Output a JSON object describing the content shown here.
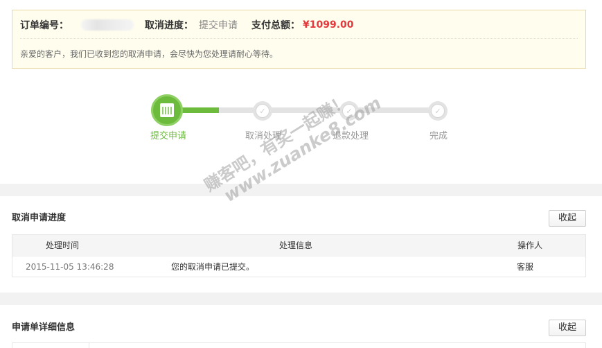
{
  "notice": {
    "order_label": "订单编号：",
    "progress_label": "取消进度：",
    "progress_value": "提交申请",
    "total_label": "支付总额：",
    "total_value": "¥1099.00",
    "message": "亲爱的客户，我们已收到您的取消申请，会尽快为您处理请耐心等待。"
  },
  "steps": [
    {
      "label": "提交申请",
      "state": "active",
      "icon": "calendar-icon"
    },
    {
      "label": "取消处理",
      "state": "pending",
      "icon": "check-icon"
    },
    {
      "label": "退款处理",
      "state": "pending",
      "icon": "check-icon"
    },
    {
      "label": "完成",
      "state": "pending",
      "icon": "check-icon"
    }
  ],
  "progress_section": {
    "title": "取消申请进度",
    "collapse_label": "收起",
    "columns": {
      "time": "处理时间",
      "info": "处理信息",
      "operator": "操作人"
    },
    "rows": [
      {
        "time": "2015-11-05 13:46:28",
        "info": "您的取消申请已提交。",
        "operator": "客服"
      }
    ]
  },
  "detail_section": {
    "title": "申请单详细信息",
    "collapse_label": "收起"
  },
  "watermark": {
    "line1": "赚客吧，有奖一起赚！",
    "line2": "www.zuanke8.com"
  },
  "colors": {
    "accent_green": "#6cbb3c",
    "price_red": "#e4393c",
    "notice_bg": "#fffdee"
  }
}
